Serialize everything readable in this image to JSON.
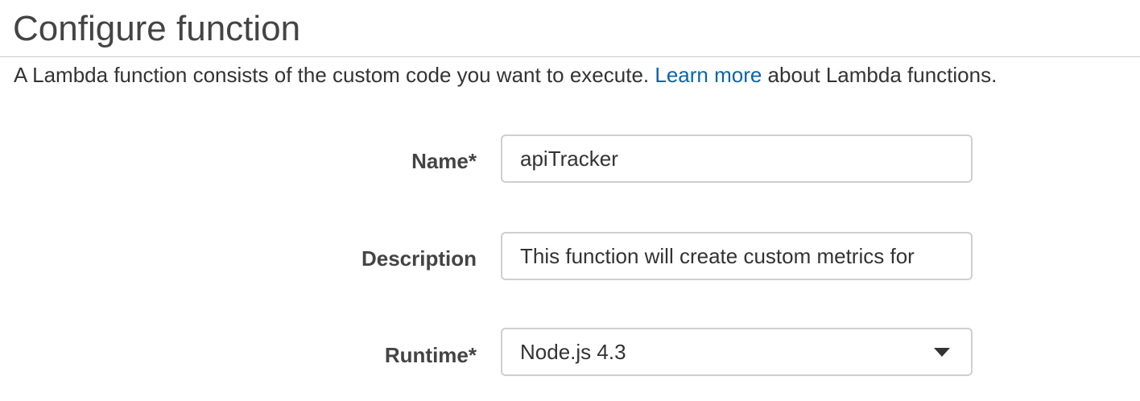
{
  "header": {
    "title": "Configure function"
  },
  "intro": {
    "text_before": "A Lambda function consists of the custom code you want to execute. ",
    "link_text": "Learn more",
    "text_after": " about Lambda functions."
  },
  "form": {
    "name": {
      "label": "Name*",
      "value": "apiTracker"
    },
    "description": {
      "label": "Description",
      "value": "This function will create custom metrics for"
    },
    "runtime": {
      "label": "Runtime*",
      "selected": "Node.js 4.3",
      "icon": "caret-down-icon"
    }
  }
}
